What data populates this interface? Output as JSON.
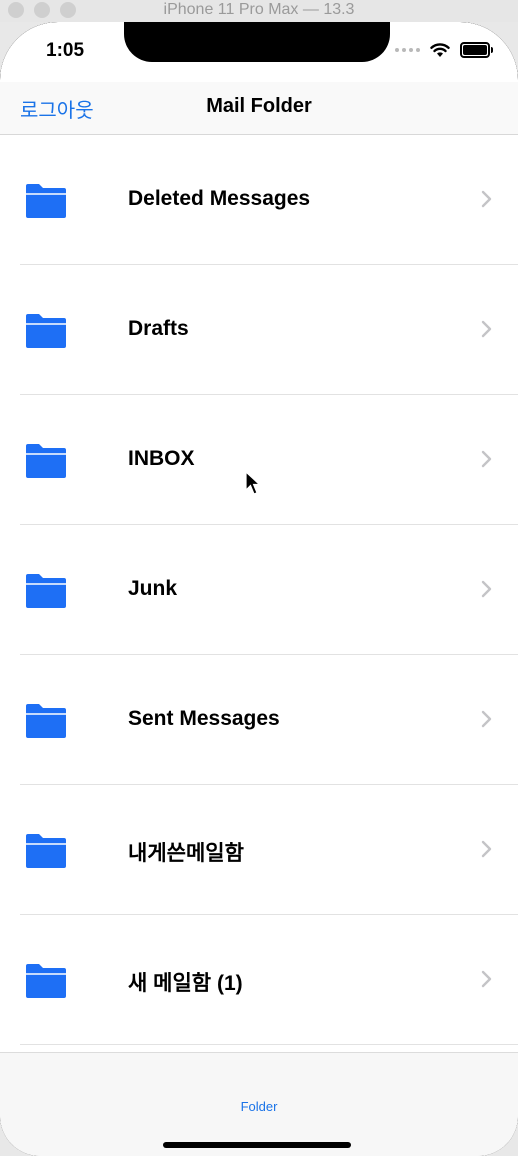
{
  "window": {
    "title": "iPhone 11 Pro Max — 13.3"
  },
  "status_bar": {
    "time": "1:05"
  },
  "navbar": {
    "left_button": "로그아웃",
    "title": "Mail Folder"
  },
  "folders": [
    {
      "label": "Deleted Messages",
      "icon": "folder-icon"
    },
    {
      "label": "Drafts",
      "icon": "folder-icon"
    },
    {
      "label": "INBOX",
      "icon": "folder-icon"
    },
    {
      "label": "Junk",
      "icon": "folder-icon"
    },
    {
      "label": "Sent Messages",
      "icon": "folder-icon"
    },
    {
      "label": "내게쓴메일함",
      "icon": "folder-icon"
    },
    {
      "label": "새 메일함 (1)",
      "icon": "folder-icon"
    }
  ],
  "tab_bar": {
    "items": [
      {
        "label": "Folder"
      }
    ]
  },
  "colors": {
    "accent": "#1a73e8",
    "folder": "#1e6ff5"
  }
}
